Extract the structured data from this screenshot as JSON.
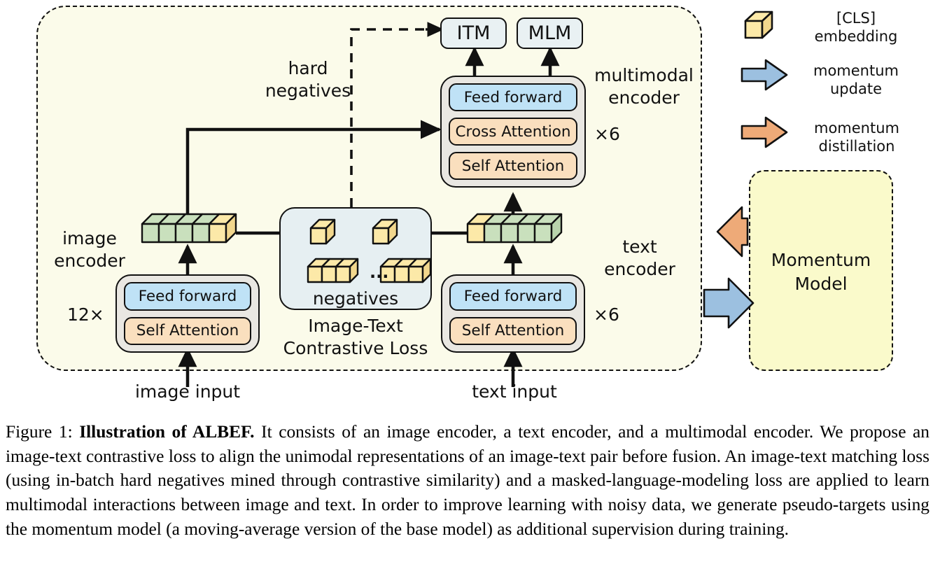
{
  "diagram": {
    "heads": [
      {
        "id": "itm",
        "label": "ITM"
      },
      {
        "id": "mlm",
        "label": "MLM"
      }
    ],
    "multimodal_encoder": {
      "title": "multimodal\nencoder",
      "repeat": "×6",
      "layers": [
        "Feed forward",
        "Cross Attention",
        "Self Attention"
      ]
    },
    "image_encoder": {
      "title": "image\nencoder",
      "repeat": "12×",
      "layers": [
        "Feed forward",
        "Self Attention"
      ],
      "input_label": "image input"
    },
    "text_encoder": {
      "title": "text\nencoder",
      "repeat": "×6",
      "layers": [
        "Feed forward",
        "Self Attention"
      ],
      "input_label": "text input"
    },
    "itc": {
      "negatives_label": "negatives",
      "ellipsis": "...",
      "caption": "Image-Text\nContrastive Loss"
    },
    "hard_negatives_label": "hard\nnegatives",
    "momentum_model": "Momentum\nModel"
  },
  "legend": [
    {
      "icon": "cube-icon",
      "label": "[CLS]\nembedding"
    },
    {
      "icon": "arrow-right-blue-icon",
      "label": "momentum\nupdate"
    },
    {
      "icon": "arrow-right-orange-icon",
      "label": "momentum\ndistillation"
    }
  ],
  "colors": {
    "canvas": "#ffffff",
    "container_bg": "#fbfbea",
    "momentum_bg": "#fafacb",
    "feed_forward": "#bfe2f6",
    "attention": "#fadfbe",
    "encoder_shell": "#e9e7e2",
    "head_box": "#e9f1f3",
    "itc_box": "#e6eff2",
    "cube_yellow": "#fce9a8",
    "cube_green": "#c9e0bd",
    "arrow_blue": "#9cc0e0",
    "arrow_orange": "#eeaa78",
    "stroke": "#111111"
  },
  "caption": {
    "figure_number": "Figure 1:",
    "bold_title": "Illustration of ALBEF.",
    "body": " It consists of an image encoder, a text encoder, and a multimodal encoder. We propose an image-text contrastive loss to align the unimodal representations of an image-text pair before fusion. An image-text matching loss (using in-batch hard negatives mined through contrastive similarity) and a masked-language-modeling loss are applied to learn multimodal interactions between image and text. In order to improve learning with noisy data, we generate pseudo-targets using the momentum model (a moving-average version of the base model) as additional supervision during training."
  }
}
